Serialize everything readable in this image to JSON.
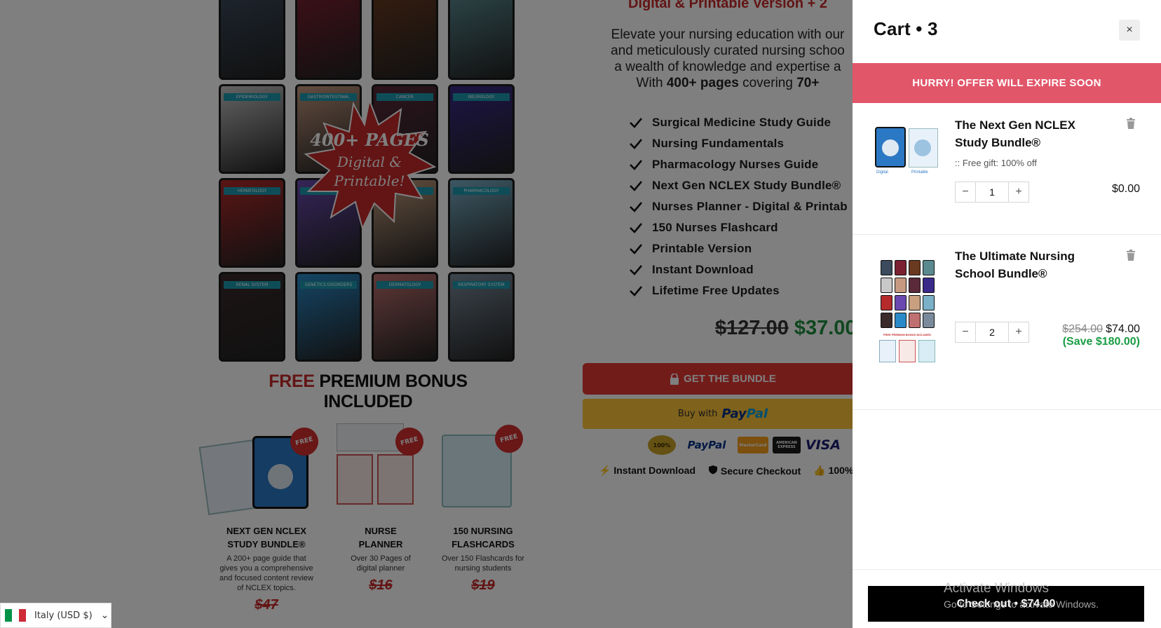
{
  "page": {
    "tile_labels": [
      "",
      "",
      "",
      "",
      "EPIDEMIOLOGY",
      "GASTROINTESTINAL",
      "CANCER",
      "NEUROLOGY",
      "HEMATOLOGY",
      "REPRO",
      "SKELETAL",
      "PHARMACOLOGY",
      "RENAL SYSTEM",
      "GENETICS DISORDERS",
      "DERMATOLOGY",
      "RESPIRATORY SYSTEM"
    ],
    "tile_colors": [
      "#3b4a5c",
      "#7a2030",
      "#6a3a20",
      "#5a8a90",
      "#c8c8c8",
      "#c69a80",
      "#5a2a3a",
      "#3a2a8a",
      "#b52a2a",
      "#6a4ab0",
      "#c8a080",
      "#7ab0c8",
      "#3a2a2a",
      "#2a8ac8",
      "#c07070",
      "#7a8a9a"
    ],
    "starburst_line1": "400+ PAGES",
    "starburst_line2": "Digital &",
    "starburst_line3": "Printable!",
    "subtitle": "Digital & Printable Version + 2",
    "intro_line1": "Elevate your nursing education with our",
    "intro_line2": "and meticulously curated nursing schoo",
    "intro_line3": "a wealth of knowledge and expertise a",
    "intro_line4_pre": "With ",
    "intro_line4_bold1": "400+ pages",
    "intro_line4_mid": " covering ",
    "intro_line4_bold2": "70+",
    "features": [
      "Surgical Medicine Study Guide",
      "Nursing Fundamentals",
      "Pharmacology Nurses Guide",
      "Next Gen NCLEX Study Bundle®",
      "Nurses Planner - Digital & Printab",
      "150 Nurses Flashcard",
      "Printable Version",
      "Instant Download",
      "Lifetime Free Updates"
    ],
    "price_old": "$127.00",
    "price_new": "$37.00",
    "bundle_button": "GET THE BUNDLE",
    "paypal_prefix": "Buy with",
    "paypal_brand_a": "Pay",
    "paypal_brand_b": "Pal",
    "pay_logos": [
      "100%",
      "PayPal",
      "MasterCard",
      "AMERICAN EXPRESS",
      "VISA"
    ],
    "trust": [
      "Instant Download",
      "Secure Checkout",
      "100%"
    ],
    "bonus_title_free": "FREE",
    "bonus_title_rest": " PREMIUM BONUS INCLUDED",
    "bonus_badge": "FREE",
    "bonus": [
      {
        "title": "NEXT GEN NCLEX STUDY BUNDLE®",
        "desc": "A 200+ page guide that gives you a comprehensive and focused content review of NCLEX topics.",
        "price": "$47"
      },
      {
        "title": "NURSE PLANNER",
        "desc": "Over 30 Pages of digital planner",
        "price": "$16"
      },
      {
        "title": "150 NURSING FLASHCARDS",
        "desc": "Over 150 Flashcards for nursing students",
        "price": "$19"
      }
    ],
    "country": "Italy (USD $)",
    "flag_colors": [
      "#009246",
      "#ffffff",
      "#ce2b37"
    ]
  },
  "cart": {
    "title": "Cart • 3",
    "close_icon": "×",
    "banner": "HURRY! OFFER WILL EXPIRE SOON",
    "items": [
      {
        "title": "The Next Gen NCLEX Study Bundle®",
        "gift": ":: Free gift: 100% off",
        "qty": "1",
        "price": "$0.00",
        "img_caption_a": "Digital",
        "img_caption_b": "Printable"
      },
      {
        "title": "The Ultimate Nursing School Bundle®",
        "qty": "2",
        "price_old": "$254.00",
        "price": "$74.00",
        "save": "(Save $180.00)",
        "img_caption": "FREE PREMIUM BONUS INCLUDED"
      }
    ],
    "checkout": "Check out • $74.00"
  },
  "watermark": {
    "line1": "Activate Windows",
    "line2": "Go to Settings to activate Windows."
  },
  "colors": {
    "accent_red": "#e53935",
    "banner": "#e2566a",
    "save_green": "#1a9d43",
    "price_green": "#1e8e3e"
  }
}
